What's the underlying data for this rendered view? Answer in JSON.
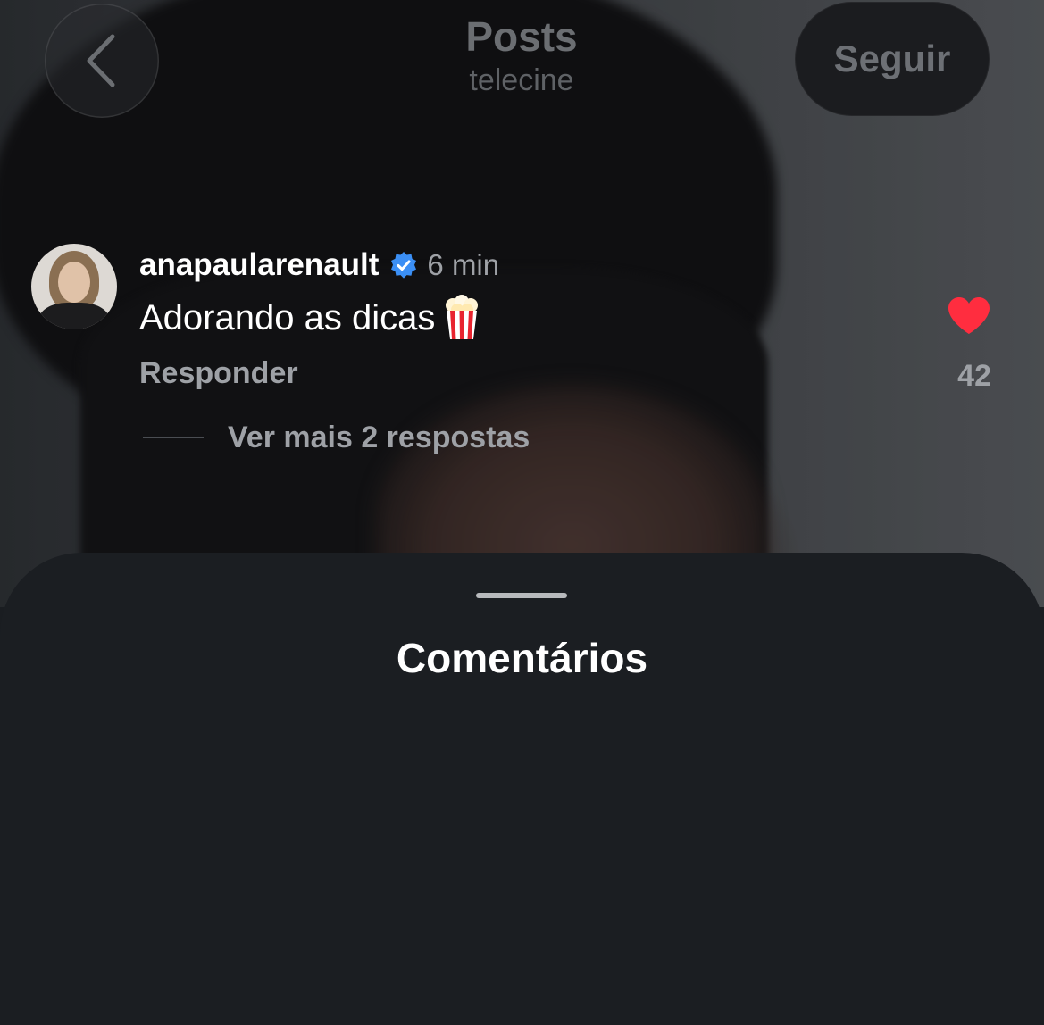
{
  "header": {
    "title": "Posts",
    "subtitle": "telecine",
    "follow_label": "Seguir",
    "back_icon": "chevron-left-icon"
  },
  "sheet": {
    "title": "Comentários"
  },
  "comment": {
    "username": "anapaularenault",
    "verified": true,
    "time": "6 min",
    "text": "Adorando as dicas",
    "emoji": "popcorn",
    "reply_label": "Responder",
    "likes": "42",
    "liked": true,
    "more_replies": "Ver mais 2 respostas"
  },
  "colors": {
    "heart": "#ff2d3f",
    "verified": "#3b8ff5",
    "sheet_bg": "#1b1e22",
    "secondary_text": "#9ea1a6"
  }
}
